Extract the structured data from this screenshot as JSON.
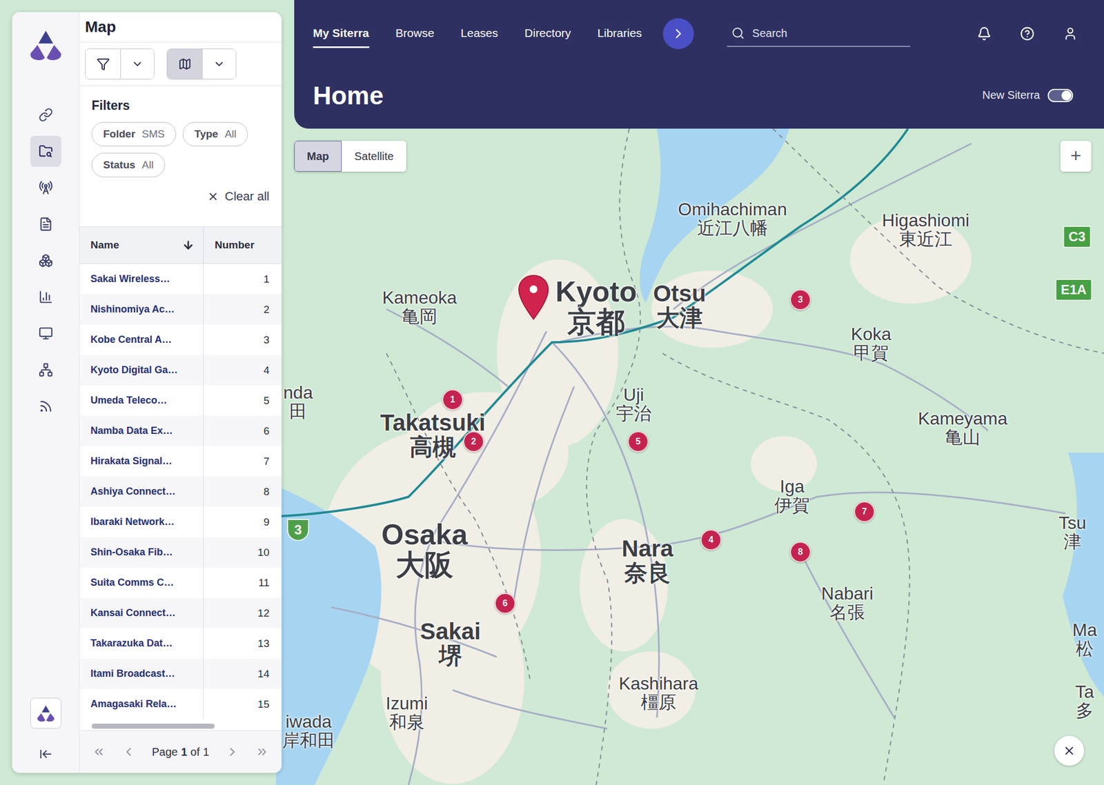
{
  "panel": {
    "title": "Map"
  },
  "rail": {
    "items": [
      {
        "selected": false
      },
      {
        "selected": true
      },
      {
        "selected": false
      },
      {
        "selected": false
      },
      {
        "selected": false
      },
      {
        "selected": false
      },
      {
        "selected": false
      },
      {
        "selected": false
      },
      {
        "selected": false
      }
    ]
  },
  "toolbar": {
    "buttons": [
      {
        "kind": "filter",
        "selected": false
      },
      {
        "kind": "map",
        "selected": true
      }
    ]
  },
  "filters": {
    "title": "Filters",
    "chips": [
      {
        "label": "Folder",
        "value": "SMS"
      },
      {
        "label": "Type",
        "value": "All"
      },
      {
        "label": "Status",
        "value": "All"
      }
    ],
    "clear": "Clear all"
  },
  "table": {
    "columns": [
      {
        "label": "Name",
        "sorted": "desc"
      },
      {
        "label": "Number",
        "sorted": "none"
      }
    ],
    "rows": [
      {
        "name": "Sakai Wireless…",
        "number": "1"
      },
      {
        "name": "Nishinomiya Ac…",
        "number": "2"
      },
      {
        "name": "Kobe Central A…",
        "number": "3"
      },
      {
        "name": "Kyoto Digital Ga…",
        "number": "4"
      },
      {
        "name": "Umeda Teleco…",
        "number": "5"
      },
      {
        "name": "Namba Data Ex…",
        "number": "6"
      },
      {
        "name": "Hirakata Signal…",
        "number": "7"
      },
      {
        "name": "Ashiya Connect…",
        "number": "8"
      },
      {
        "name": "Ibaraki Network…",
        "number": "9"
      },
      {
        "name": "Shin-Osaka Fib…",
        "number": "10"
      },
      {
        "name": "Suita Comms C…",
        "number": "11"
      },
      {
        "name": "Kansai Connect…",
        "number": "12"
      },
      {
        "name": "Takarazuka Dat…",
        "number": "13"
      },
      {
        "name": "Itami Broadcast…",
        "number": "14"
      },
      {
        "name": "Amagasaki Rela…",
        "number": "15"
      }
    ]
  },
  "pagination": {
    "prefix": "Page",
    "current": "1",
    "separator": "of",
    "total": "1",
    "nav": [
      {
        "kind": "first",
        "disabled": true
      },
      {
        "kind": "prev",
        "disabled": true
      },
      {
        "kind": "next",
        "disabled": true
      },
      {
        "kind": "last",
        "disabled": true
      }
    ]
  },
  "header": {
    "tabs": [
      {
        "label": "My Siterra",
        "selected": true
      },
      {
        "label": "Browse",
        "selected": false
      },
      {
        "label": "Leases",
        "selected": false
      },
      {
        "label": "Directory",
        "selected": false
      },
      {
        "label": "Libraries",
        "selected": false
      }
    ],
    "search": {
      "placeholder": "Search"
    },
    "title": "Home",
    "toggle": {
      "label": "New Siterra",
      "on": true
    }
  },
  "map": {
    "types": [
      {
        "label": "Map",
        "selected": true
      },
      {
        "label": "Satellite",
        "selected": false
      }
    ],
    "zoom_in": "+",
    "labels": [
      {
        "latin": "Omihachiman",
        "kanji": "近江八幡",
        "kind": "minor"
      },
      {
        "latin": "Higashiomi",
        "kanji": "東近江",
        "kind": "minor"
      },
      {
        "latin": "Kameoka",
        "kanji": "亀岡",
        "kind": "minor"
      },
      {
        "latin": "Kyoto",
        "kanji": "京都",
        "kind": "major"
      },
      {
        "latin": "Otsu",
        "kanji": "大津",
        "kind": "medium"
      },
      {
        "latin": "Koka",
        "kanji": "甲賀",
        "kind": "minor"
      },
      {
        "latin": "Uji",
        "kanji": "宇治",
        "kind": "minor"
      },
      {
        "latin": "Takatsuki",
        "kanji": "高槻",
        "kind": "medium"
      },
      {
        "latin": "Kameyama",
        "kanji": "亀山",
        "kind": "minor"
      },
      {
        "latin": "Iga",
        "kanji": "伊賀",
        "kind": "minor"
      },
      {
        "latin": "Osaka",
        "kanji": "大阪",
        "kind": "major"
      },
      {
        "latin": "Nara",
        "kanji": "奈良",
        "kind": "medium"
      },
      {
        "latin": "Nabari",
        "kanji": "名張",
        "kind": "minor"
      },
      {
        "latin": "Sakai",
        "kanji": "堺",
        "kind": "medium"
      },
      {
        "latin": "Kashihara",
        "kanji": "橿原",
        "kind": "minor"
      },
      {
        "latin": "Izumi",
        "kanji": "和泉",
        "kind": "minor"
      },
      {
        "latin": "Tsu",
        "kanji": "津",
        "kind": "minor"
      },
      {
        "latin": "nda",
        "kanji": "田",
        "kind": "minor"
      },
      {
        "latin": "iwada",
        "kanji": "岸和田",
        "kind": "minor"
      },
      {
        "latin": "Ma",
        "kanji": "松",
        "kind": "minor"
      },
      {
        "latin": "Ta",
        "kanji": "多",
        "kind": "minor"
      }
    ],
    "shields": [
      {
        "text": "C3",
        "kind": "plate"
      },
      {
        "text": "E1A",
        "kind": "plate"
      },
      {
        "text": "3",
        "kind": "round"
      }
    ],
    "pins": [
      {
        "number": "1"
      },
      {
        "number": "2"
      },
      {
        "number": "3"
      },
      {
        "number": "4"
      },
      {
        "number": "5"
      },
      {
        "number": "6"
      },
      {
        "number": "7"
      },
      {
        "number": "8"
      }
    ],
    "selected_marker": {
      "shown": true
    }
  }
}
